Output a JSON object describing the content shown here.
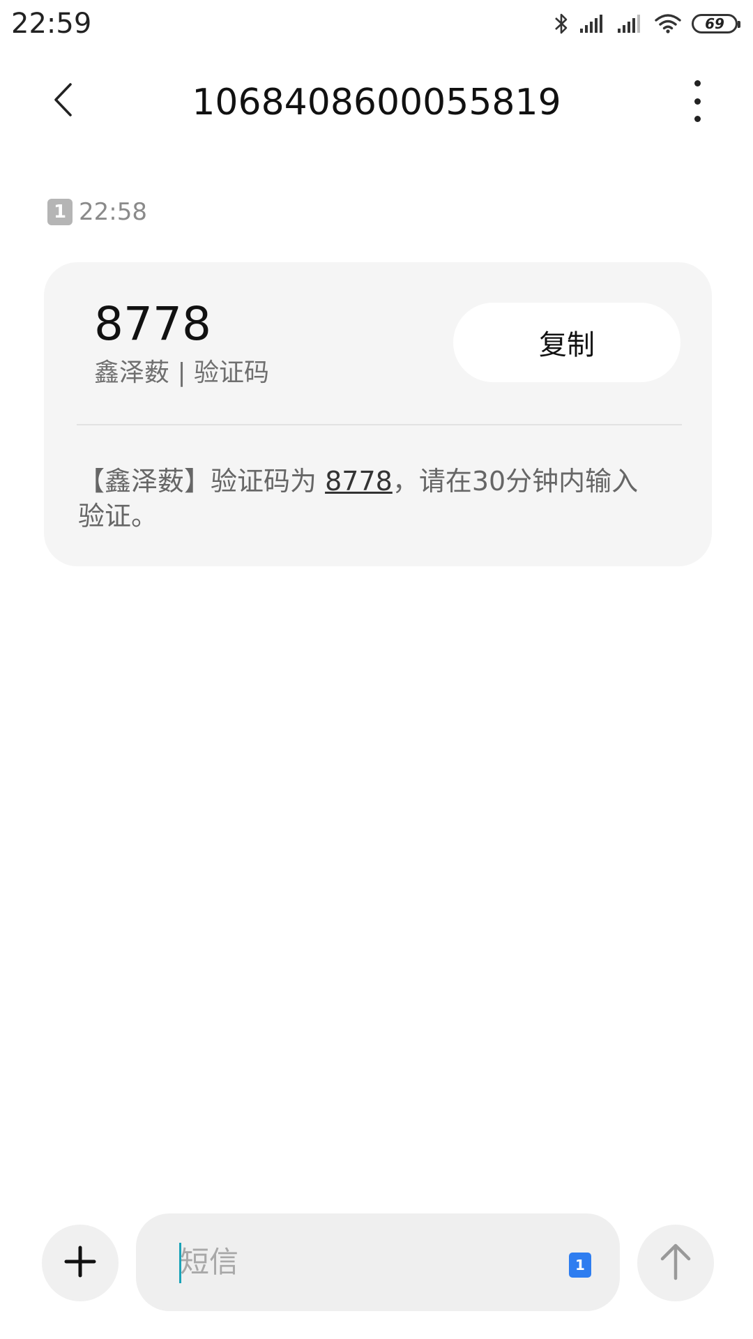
{
  "status_bar": {
    "time": "22:59",
    "battery_level": "69",
    "icons": [
      "bluetooth-icon",
      "signal-icon",
      "signal-icon",
      "wifi-icon",
      "battery-icon"
    ]
  },
  "header": {
    "title": "1068408600055819",
    "back_icon": "chevron-left-icon",
    "more_icon": "more-vertical-icon"
  },
  "message": {
    "sim_slot": "1",
    "time": "22:58",
    "code": "8778",
    "sender_line": "鑫泽薮 | 验证码",
    "copy_label": "复制",
    "body_before": "【鑫泽薮】验证码为 ",
    "body_code": "8778",
    "body_after": "，请在30分钟内输入验证。"
  },
  "composer": {
    "placeholder": "短信",
    "sim_slot": "1",
    "add_icon": "plus-icon",
    "send_icon": "arrow-up-icon"
  },
  "colors": {
    "card_bg": "#f5f5f5",
    "sim_select": "#2e7df0",
    "cursor": "#1aa3b8"
  }
}
